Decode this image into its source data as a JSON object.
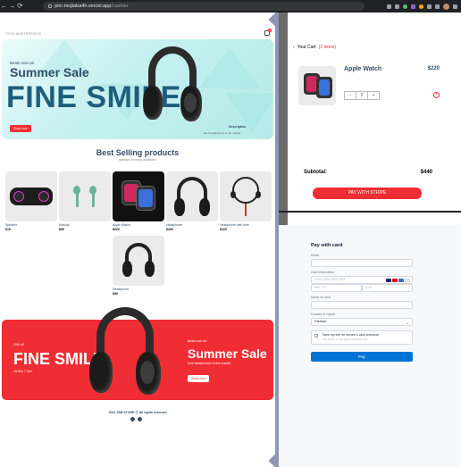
{
  "browser": {
    "url_host": "poc-mujtaba4h.vercel.app",
    "url_path": "/cashier",
    "nav": {
      "back": "←",
      "forward": "→",
      "reload": "⟳"
    }
  },
  "store": {
    "logo": "TECH MASTERPIECE",
    "cart_count": "1",
    "hero": {
      "small_text": "Beats solo air",
      "mid_text": "Summer Sale",
      "large_text": "FINE SMILE",
      "button": "Shop now",
      "desc_title": "Description",
      "desc_text": "best headphones in the market"
    },
    "section_title": "Best Selling products",
    "section_subtitle": "speaker of many variations",
    "products": [
      {
        "name": "Speaker",
        "price": "$19"
      },
      {
        "name": "Airbuds",
        "price": "$99"
      },
      {
        "name": "Apple Watch",
        "price": "$220"
      },
      {
        "name": "Headphone",
        "price": "$400"
      },
      {
        "name": "Headphone with wire",
        "price": "$120"
      },
      {
        "name": "Headphone",
        "price": "$99"
      }
    ],
    "footer_banner": {
      "small_left": "20% off",
      "big_left": "FINE SMILE",
      "sub_left": "15 Nov 7 Dec",
      "small_right": "Beats solo air",
      "big_right": "Summer Sale",
      "sub_right": "best headphones in the market",
      "button": "Shop now"
    },
    "copyright": "2022 JSM STORE ⓒ All rights reserved"
  },
  "cart": {
    "back_icon": "‹",
    "heading": "Your Cart",
    "count": "(2 items)",
    "item": {
      "name": "Apple Watch",
      "price": "$220",
      "qty_minus": "−",
      "qty_value": "2",
      "qty_plus": "+",
      "remove": "×"
    },
    "subtotal_label": "Subtotal:",
    "subtotal_value": "$440",
    "pay_button": "PAY WITH STRIPE"
  },
  "checkout": {
    "title": "Pay with card",
    "email_label": "Email",
    "email_value": "",
    "card_label": "Card information",
    "card_placeholder": "1234 1234 1234 1234",
    "expiry_placeholder": "MM / YY",
    "cvc_placeholder": "CVC",
    "name_label": "Name on card",
    "name_value": "",
    "country_label": "Country or region",
    "country_value": "Pakistan",
    "save_info_title": "Save my info for secure 1-click checkout",
    "save_info_desc": "Pay faster on this site and across Link",
    "pay_button": "Pay"
  },
  "colors": {
    "accent_red": "#f02d34",
    "text_navy": "#324d67",
    "stripe_blue": "#0074d4",
    "divider": "#8c97b3"
  }
}
